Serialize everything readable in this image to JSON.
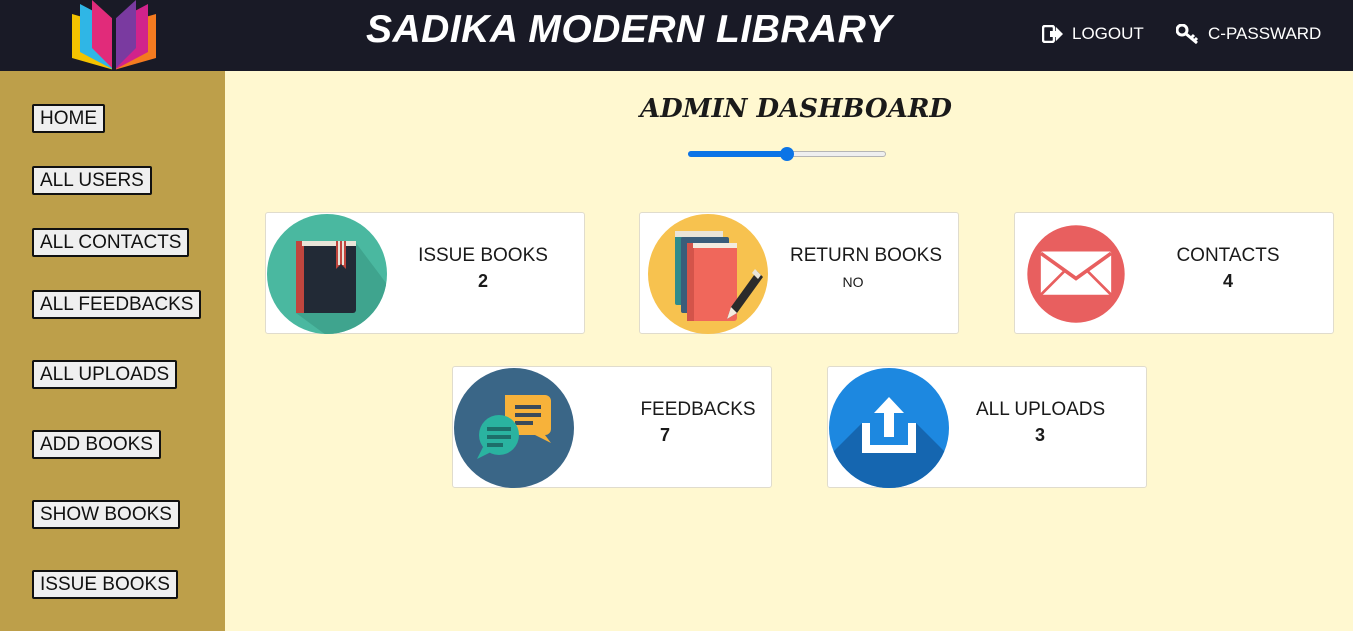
{
  "header": {
    "title": "SADIKA MODERN LIBRARY",
    "logout_label": "LOGOUT",
    "change_password_label": "C-PASSWARD"
  },
  "sidebar": {
    "items": [
      {
        "label": "HOME"
      },
      {
        "label": "ALL USERS"
      },
      {
        "label": "ALL CONTACTS"
      },
      {
        "label": "ALL FEEDBACKS"
      },
      {
        "label": "ALL UPLOADS"
      },
      {
        "label": "ADD BOOKS"
      },
      {
        "label": "SHOW BOOKS"
      },
      {
        "label": "ISSUE BOOKS"
      }
    ]
  },
  "main": {
    "title": "ADMIN DASHBOARD",
    "slider_value_percent": 50,
    "cards": [
      {
        "label": "ISSUE BOOKS",
        "value": "2",
        "icon": "closed-book-icon",
        "color": "#4ab8a0"
      },
      {
        "label": "RETURN BOOKS",
        "value": "NO",
        "icon": "books-and-pencil-icon",
        "color": "#f7c24f"
      },
      {
        "label": "CONTACTS",
        "value": "4",
        "icon": "envelope-icon",
        "color": "#e85f5f"
      },
      {
        "label": "FEEDBACKS",
        "value": "7",
        "icon": "chat-bubbles-icon",
        "color": "#3a6687"
      },
      {
        "label": "ALL UPLOADS",
        "value": "3",
        "icon": "upload-icon",
        "color": "#1d88e0"
      }
    ]
  },
  "colors": {
    "header_bg": "#191a26",
    "sidebar_bg": "#bd9f4a",
    "content_bg": "#fff8d0",
    "slider_accent": "#0b74e6"
  }
}
